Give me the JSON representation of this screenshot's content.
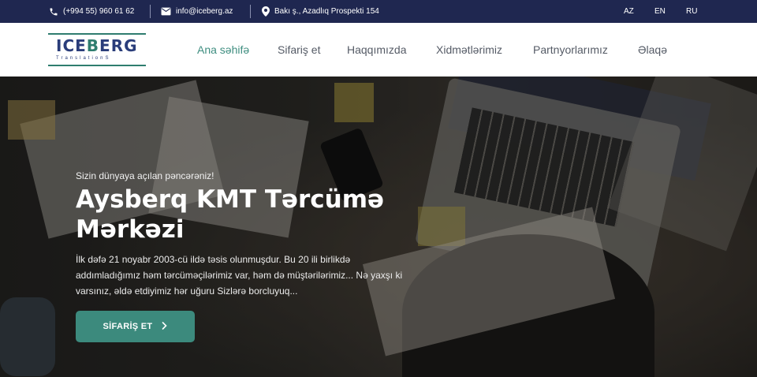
{
  "topbar": {
    "phone": "(+994 55) 960 61 62",
    "email": "info@iceberg.az",
    "address": "Bakı ş., Azadlıq Prospekti 154",
    "languages": [
      "AZ",
      "EN",
      "RU"
    ]
  },
  "logo": {
    "word_start": "ICE",
    "word_accent": "B",
    "word_end": "ERG",
    "subtitle": "TranslationS"
  },
  "nav": {
    "items": [
      "Ana səhifə",
      "Sifariş et",
      "Haqqımızda",
      "Xidmətlərimiz",
      "Partnyorlarımız",
      "Əlaqə"
    ],
    "active_index": 0
  },
  "hero": {
    "tagline": "Sizin dünyaya açılan pəncərəniz!",
    "title": "Aysberq KMT Tərcümə Mərkəzi",
    "description": "İlk dəfə 21 noyabr 2003-cü ildə təsis olunmuşdur. Bu 20 ili birlikdə addımladığımız həm tərcüməçilərimiz var, həm də müştərilərimiz... Nə yaxşı ki varsınız, əldə etdiyimiz hər uğuru Sizlərə borcluyuq...",
    "cta_label": "SİFARİŞ ET"
  },
  "colors": {
    "topbar_bg": "#1f2750",
    "accent": "#3c8a7d",
    "logo_blue": "#2a3d7a"
  }
}
